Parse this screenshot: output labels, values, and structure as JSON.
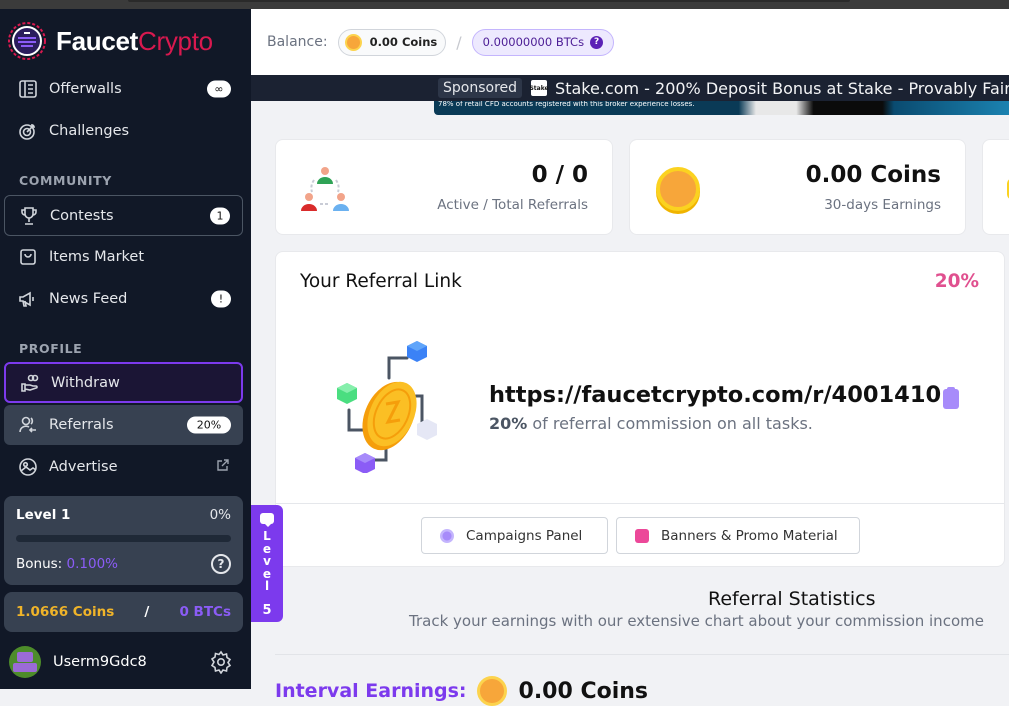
{
  "app": {
    "logo_part1": "Faucet",
    "logo_part2": "Crypto",
    "brand_color": "#d9194f",
    "accent_color": "#7c3aed"
  },
  "sidebar": {
    "items_top": [
      {
        "label": "Offerwalls",
        "badge": "∞",
        "icon": "offerwalls-icon"
      },
      {
        "label": "Challenges",
        "badge": null,
        "icon": "target-icon"
      }
    ],
    "community_label": "COMMUNITY",
    "community_items": [
      {
        "label": "Contests",
        "badge": "1",
        "icon": "trophy-icon"
      },
      {
        "label": "Items Market",
        "badge": null,
        "icon": "shopping-bag-icon"
      },
      {
        "label": "News Feed",
        "badge": "!",
        "icon": "megaphone-icon"
      }
    ],
    "profile_label": "PROFILE",
    "profile_items": [
      {
        "label": "Withdraw",
        "badge": null,
        "icon": "withdraw-hand-icon"
      },
      {
        "label": "Referrals",
        "badge": "20%",
        "icon": "referrals-icon"
      },
      {
        "label": "Advertise",
        "badge": null,
        "icon": "image-icon",
        "external": true
      }
    ],
    "level": {
      "label": "Level 1",
      "percent_text": "0%",
      "progress": 0,
      "bonus_label": "Bonus:",
      "bonus_value": "0.100%"
    },
    "balance": {
      "coins": "1.0666 Coins",
      "separator": "/",
      "btcs": "0 BTCs"
    },
    "user": {
      "name": "Userm9Gdc8"
    }
  },
  "header": {
    "balance_label": "Balance:",
    "coins": "0.00 Coins",
    "separator": "/",
    "btcs": "0.00000000 BTCs",
    "help": "?"
  },
  "ad": {
    "sponsored_label": "Sponsored",
    "logo_text": "Stake",
    "text": "Stake.com - 200% Deposit Bonus at Stake - Provably Fair",
    "disclaimer": "78% of retail CFD accounts registered with this broker experience losses."
  },
  "stats_cards": [
    {
      "value": "0 / 0",
      "label": "Active / Total Referrals",
      "icon": "referral-network-icon"
    },
    {
      "value": "0.00 Coins",
      "label": "30-days Earnings",
      "icon": "coin-icon"
    }
  ],
  "referral_link": {
    "title": "Your Referral Link",
    "percent": "20%",
    "url": "https://faucetcrypto.com/r/4001410",
    "commission_bold": "20%",
    "commission_text": " of referral commission on all tasks.",
    "buttons": [
      {
        "label": "Campaigns Panel",
        "icon": "campaign-icon"
      },
      {
        "label": "Banners & Promo Material",
        "icon": "image-icon"
      }
    ]
  },
  "level_tab": {
    "text": "Level",
    "number": "5"
  },
  "referral_statistics": {
    "title": "Referral Statistics",
    "subtitle": "Track your earnings with our extensive chart about your commission income",
    "interval_label": "Interval Earnings:",
    "interval_value": "0.00 Coins"
  }
}
